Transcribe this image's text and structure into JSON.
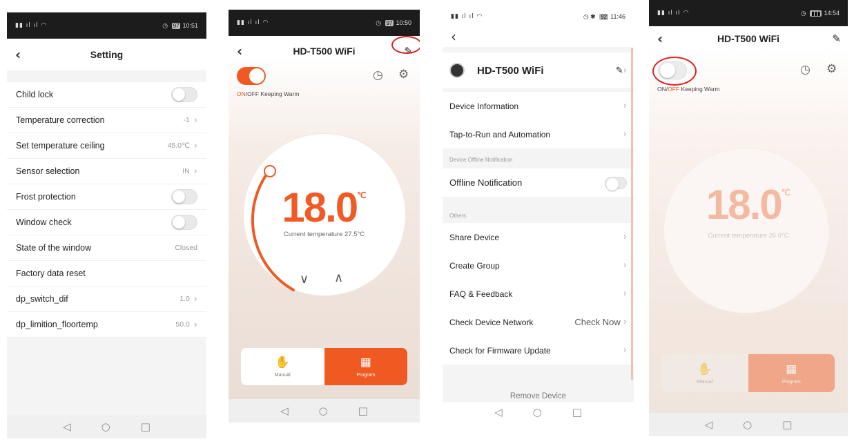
{
  "screen1": {
    "status_time": "10:51",
    "battery": "97",
    "title": "Setting",
    "rows": [
      {
        "label": "Child lock",
        "value": "",
        "toggle": true,
        "chevron": false
      },
      {
        "label": "Temperature correction",
        "value": "-1",
        "toggle": false,
        "chevron": true
      },
      {
        "label": "Set temperature ceiling",
        "value": "45.0℃",
        "toggle": false,
        "chevron": true
      },
      {
        "label": "Sensor selection",
        "value": "IN",
        "toggle": false,
        "chevron": true
      },
      {
        "label": "Frost protection",
        "value": "",
        "toggle": true,
        "chevron": false
      },
      {
        "label": "Window check",
        "value": "",
        "toggle": true,
        "chevron": false
      },
      {
        "label": "State of the window",
        "value": "Closed",
        "toggle": false,
        "chevron": false
      },
      {
        "label": "Factory data reset",
        "value": "",
        "toggle": false,
        "chevron": false
      },
      {
        "label": "dp_switch_dif",
        "value": "1.0",
        "toggle": false,
        "chevron": true
      },
      {
        "label": "dp_limition_floortemp",
        "value": "50.0",
        "toggle": false,
        "chevron": true
      }
    ]
  },
  "screen2": {
    "status_time": "10:50",
    "battery": "97",
    "title": "HD-T500 WiFi",
    "power_label_on": "ON",
    "power_label_sep": "/",
    "power_label_off": "OFF",
    "keeping_warm": "Keeping Warm",
    "set_temp": "18.0",
    "unit": "℃",
    "current_temp": "Current temperature 27.5°C",
    "mode_manual": "Manual",
    "mode_program": "Program",
    "power_state": "on"
  },
  "screen3": {
    "status_time": "11:46",
    "battery": "92",
    "device_name": "HD-T500 WiFi",
    "items_a": [
      {
        "label": "Device Information",
        "value": ""
      },
      {
        "label": "Tap-to-Run and Automation",
        "value": ""
      }
    ],
    "group_offline": "Device Offline Notification",
    "offline_label": "Offline Notification",
    "group_others": "Others",
    "items_b": [
      {
        "label": "Share Device",
        "value": ""
      },
      {
        "label": "Create Group",
        "value": ""
      },
      {
        "label": "FAQ & Feedback",
        "value": ""
      },
      {
        "label": "Check Device Network",
        "value": "Check Now"
      },
      {
        "label": "Check for Firmware Update",
        "value": ""
      }
    ],
    "remove": "Remove Device"
  },
  "screen4": {
    "status_time": "14:54",
    "title": "HD-T500 WiFi",
    "power_label_on": "ON",
    "power_label_sep": "/",
    "power_label_off": "OFF",
    "keeping_warm": "Keeping Warm",
    "set_temp": "18.0",
    "unit": "℃",
    "current_temp": "Current temperature 26.0°C",
    "mode_manual": "Manual",
    "mode_program": "Program",
    "power_state": "off"
  },
  "icons": {
    "back": "‹",
    "chevron": "›",
    "pencil": "✎",
    "clock": "◷",
    "gear": "⚙",
    "down": "∨",
    "up": "∧",
    "hand": "✋",
    "grid": "▦",
    "nav_back": "◁",
    "nav_home": "○",
    "nav_recent": "□"
  },
  "colors": {
    "accent": "#f05a22",
    "annotation": "#d22222"
  }
}
